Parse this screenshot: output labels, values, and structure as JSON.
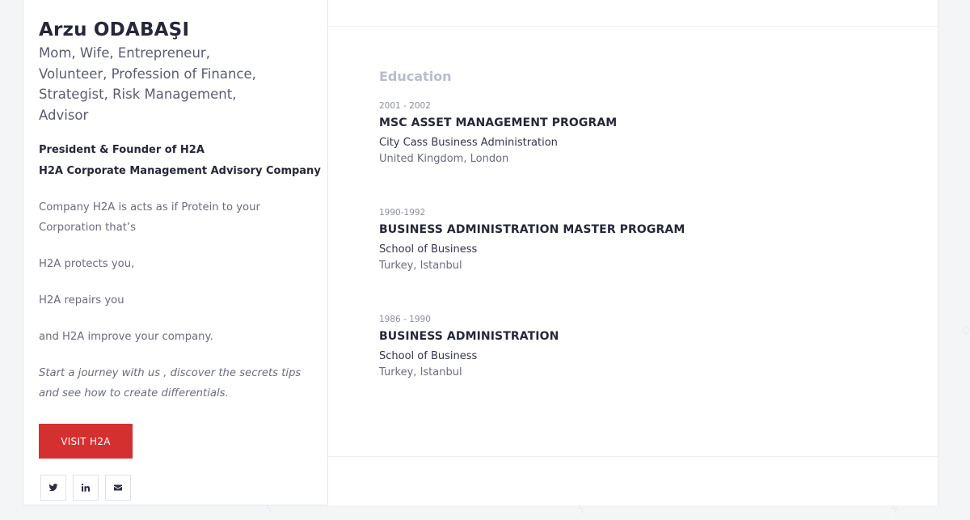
{
  "profile": {
    "name": "Arzu ODABAŞI",
    "tagline": "Mom, Wife, Entrepreneur, Volunteer, Profession of Finance, Strategist, Risk Management, Advisor",
    "role_title": "President & Founder of H2A",
    "company": "H2A Corporate Management Advisory Company",
    "description": [
      "Company H2A is acts as if Protein to your Corporation that’s",
      "H2A protects you,",
      "H2A repairs you",
      "and H2A improve your company."
    ],
    "journey": "Start a journey with us , discover the secrets tips and see how to create differentials.",
    "visit_button": "VISIT H2A",
    "social": [
      {
        "icon": "twitter-icon"
      },
      {
        "icon": "linkedin-icon"
      },
      {
        "icon": "envelope-icon"
      }
    ]
  },
  "education": {
    "title": "Education",
    "items": [
      {
        "period": "2001 - 2002",
        "degree": "MSC ASSET MANAGEMENT PROGRAM",
        "school": "City Cass Business Administration",
        "location": "United Kingdom, London"
      },
      {
        "period": "1990-1992",
        "degree": "BUSINESS ADMINISTRATION MASTER PROGRAM",
        "school": "School of Business",
        "location": "Turkey, Istanbul"
      },
      {
        "period": "1986 - 1990",
        "degree": "BUSINESS ADMINISTRATION",
        "school": "School of Business",
        "location": "Turkey, Istanbul"
      }
    ]
  },
  "colors": {
    "accent": "#d3302f",
    "heading": "#262838",
    "section_title": "#b9bcca"
  }
}
